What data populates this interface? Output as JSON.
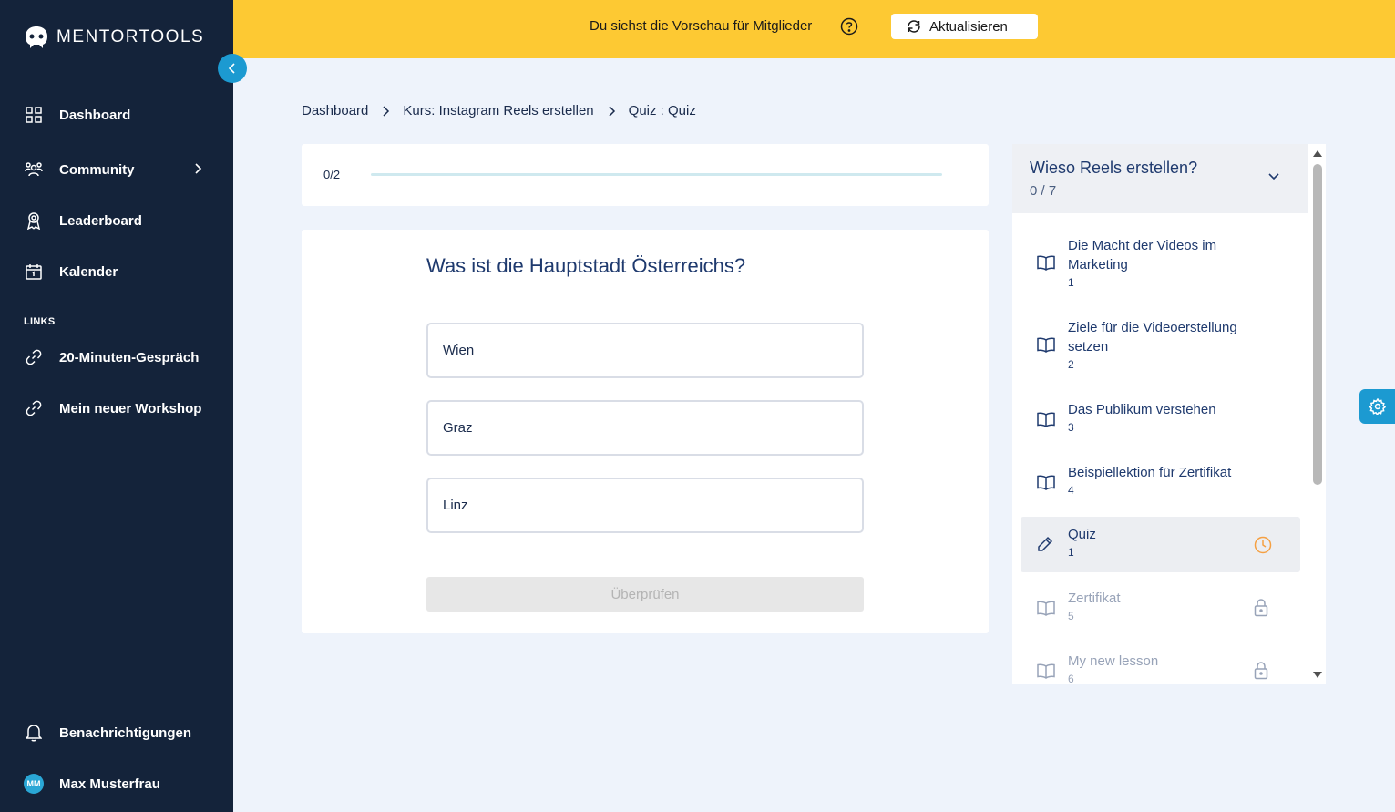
{
  "brand": {
    "name": "MENTORTOOLS"
  },
  "sidebar": {
    "items": [
      {
        "label": "Dashboard",
        "icon": "grid-icon"
      },
      {
        "label": "Community",
        "icon": "people-icon"
      },
      {
        "label": "Leaderboard",
        "icon": "award-icon"
      },
      {
        "label": "Kalender",
        "icon": "calendar-icon"
      }
    ],
    "links_label": "LINKS",
    "links": [
      {
        "label": "20-Minuten-Gespräch",
        "icon": "link-icon"
      },
      {
        "label": "Mein neuer Workshop",
        "icon": "link-icon"
      }
    ],
    "notifications_label": "Benachrichtigungen",
    "user": {
      "initials": "MM",
      "name": "Max Musterfrau"
    }
  },
  "banner": {
    "text": "Du siehst die Vorschau für Mitglieder",
    "refresh_label": "Aktualisieren"
  },
  "breadcrumb": [
    "Dashboard",
    "Kurs: Instagram Reels erstellen",
    "Quiz : Quiz"
  ],
  "progress": {
    "label": "0/2",
    "value": 0.0
  },
  "quiz": {
    "question": "Was ist die Hauptstadt Österreichs?",
    "options": [
      "Wien",
      "Graz",
      "Linz"
    ],
    "check_label": "Überprüfen"
  },
  "chapter": {
    "title": "Wieso Reels erstellen?",
    "progress": "0 / 7",
    "lessons": [
      {
        "title": "Die Macht der Videos im Marketing",
        "num": "1",
        "type": "book",
        "state": "normal"
      },
      {
        "title": "Ziele für die Videoerstellung setzen",
        "num": "2",
        "type": "book",
        "state": "normal"
      },
      {
        "title": "Das Publikum verstehen",
        "num": "3",
        "type": "book",
        "state": "normal"
      },
      {
        "title": "Beispiellektion für Zertifikat",
        "num": "4",
        "type": "book",
        "state": "normal"
      },
      {
        "title": "Quiz",
        "num": "1",
        "type": "quiz",
        "state": "active"
      },
      {
        "title": "Zertifikat",
        "num": "5",
        "type": "book",
        "state": "locked"
      },
      {
        "title": "My new lesson",
        "num": "6",
        "type": "book",
        "state": "locked"
      }
    ]
  },
  "colors": {
    "sidebar": "#14233a",
    "banner": "#fdc933",
    "accent": "#1c9ad1",
    "pending": "#f5a043"
  }
}
